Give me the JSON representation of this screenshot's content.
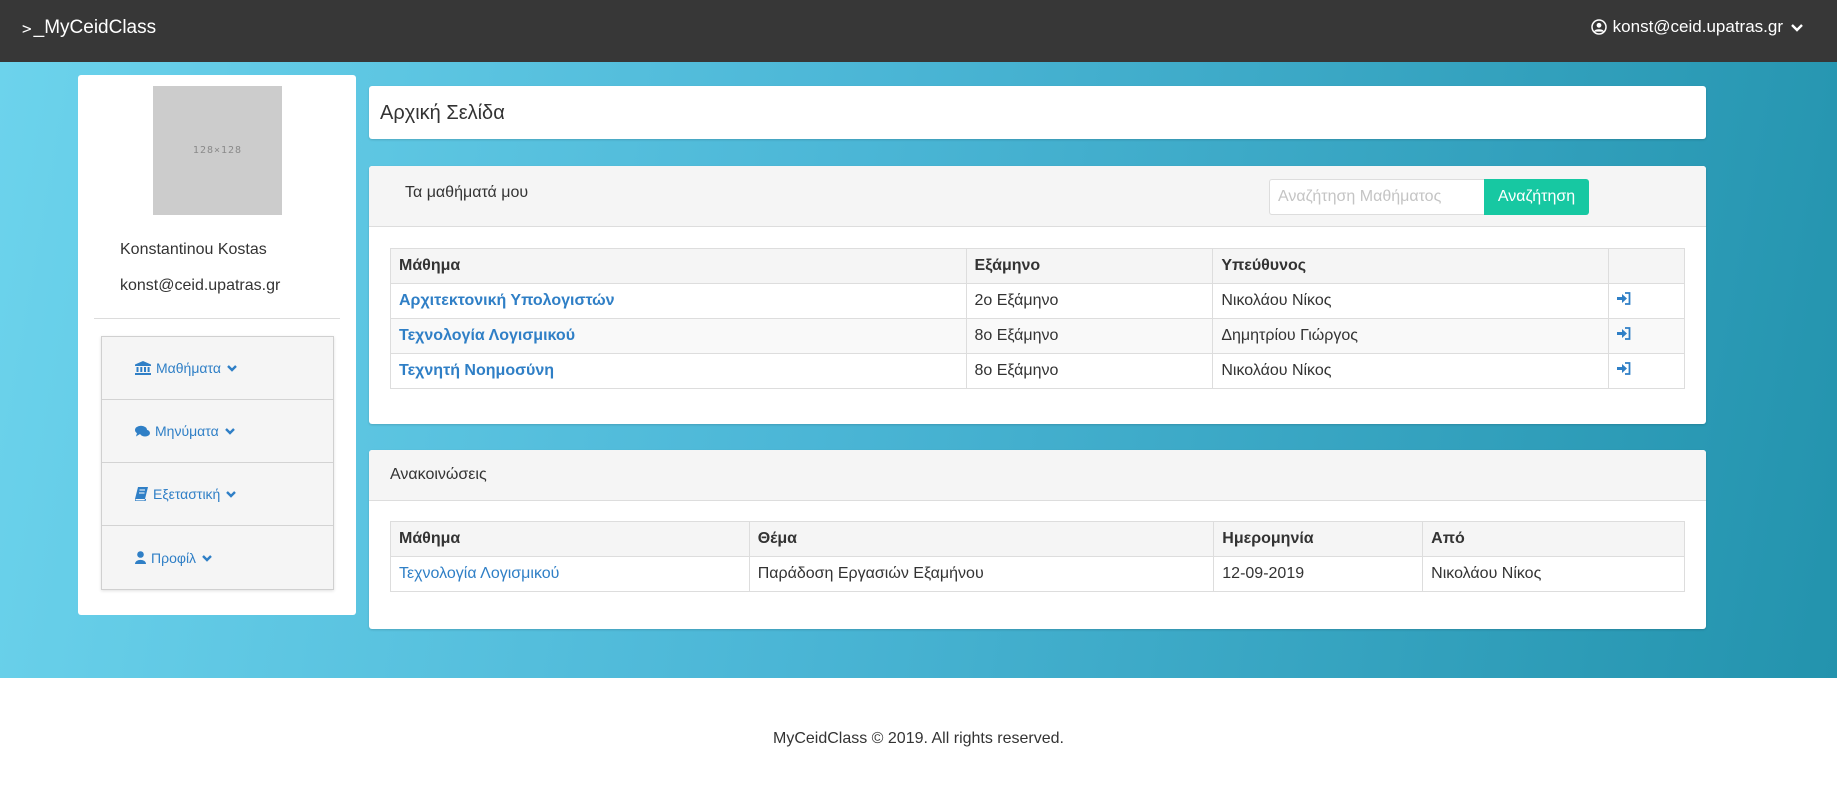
{
  "navbar": {
    "brand_prompt": ">",
    "brand": "_MyCeidClass",
    "user_email": "konst@ceid.upatras.gr"
  },
  "profile": {
    "avatar_placeholder": "128×128",
    "name": "Konstantinou Kostas",
    "email": "konst@ceid.upatras.gr"
  },
  "sidebar": {
    "items": [
      {
        "label": "Μαθήματα",
        "icon": "institution-icon"
      },
      {
        "label": "Μηνύματα",
        "icon": "comments-icon"
      },
      {
        "label": "Εξεταστική",
        "icon": "book-icon"
      },
      {
        "label": "Προφίλ",
        "icon": "user-icon"
      }
    ]
  },
  "page": {
    "title": "Αρχική Σελίδα"
  },
  "courses": {
    "title": "Τα μαθήματά μου",
    "search_placeholder": "Αναζήτηση Μαθήματος",
    "search_button": "Αναζήτηση",
    "columns": [
      "Μάθημα",
      "Εξάμηνο",
      "Υπεύθυνος",
      ""
    ],
    "rows": [
      {
        "course": "Αρχιτεκτονική Υπολογιστών",
        "semester": "2ο Εξάμηνο",
        "instructor": "Νικολάου Νίκος"
      },
      {
        "course": "Τεχνολογία Λογισμικού",
        "semester": "8ο Εξάμηνο",
        "instructor": "Δημητρίου Γιώργος"
      },
      {
        "course": "Τεχνητή Νοημοσύνη",
        "semester": "8ο Εξάμηνο",
        "instructor": "Νικολάου Νίκος"
      }
    ]
  },
  "announcements": {
    "title": "Ανακοινώσεις",
    "columns": [
      "Μάθημα",
      "Θέμα",
      "Ημερομηνία",
      "Από"
    ],
    "rows": [
      {
        "course": "Τεχνολογία Λογισμικού",
        "subject": "Παράδοση Εργασιών Εξαμήνου",
        "date": "12-09-2019",
        "from": "Νικολάου Νίκος"
      }
    ]
  },
  "footer": {
    "text": "MyCeidClass © 2019. All rights reserved."
  },
  "colors": {
    "navbar": "#373737",
    "accent": "#2f7fc6",
    "search_button": "#17c8a2"
  }
}
